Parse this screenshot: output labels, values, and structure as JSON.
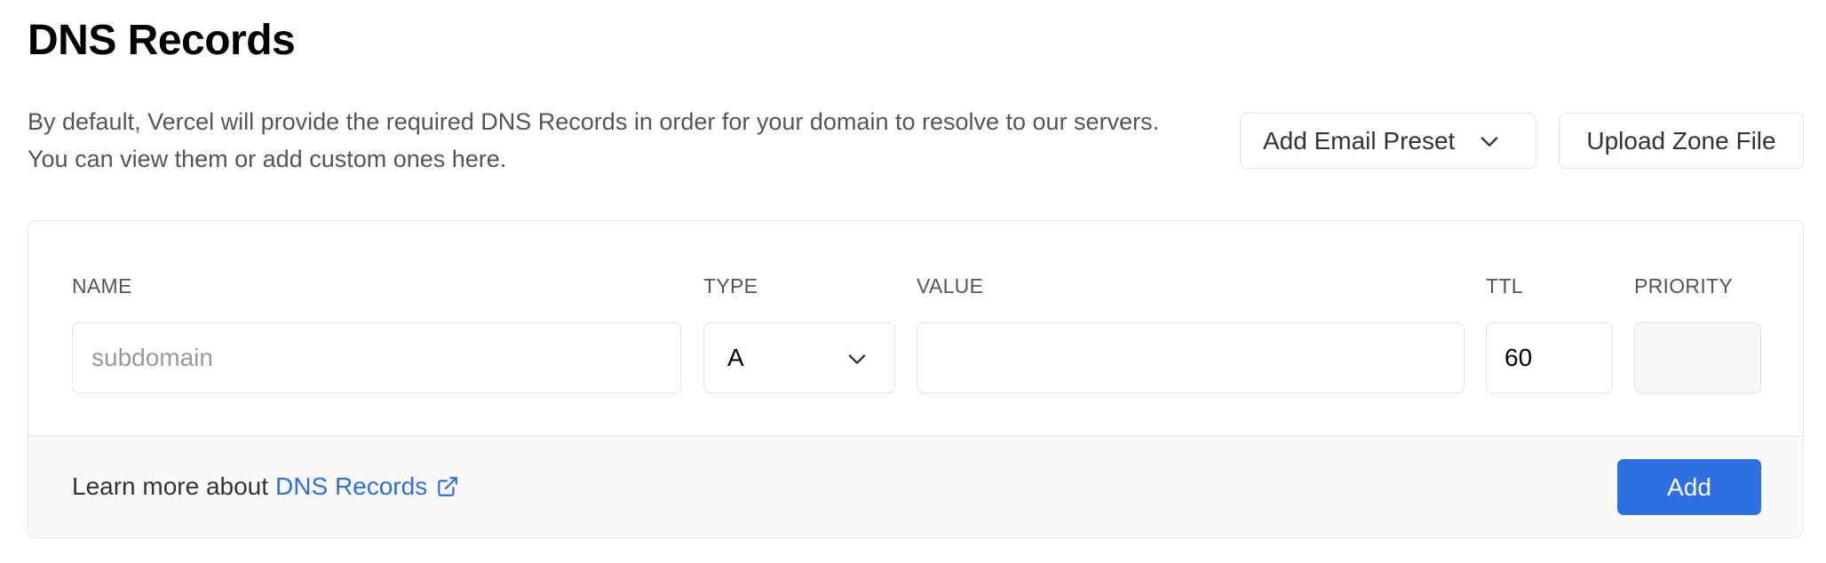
{
  "page": {
    "title": "DNS Records",
    "description": "By default, Vercel will provide the required DNS Records in order for your domain to resolve to our servers. You can view them or add custom ones here."
  },
  "actions": {
    "email_preset_label": "Add Email Preset",
    "upload_zone_label": "Upload Zone File"
  },
  "form": {
    "name_label": "NAME",
    "name_placeholder": "subdomain",
    "type_label": "TYPE",
    "type_value": "A",
    "value_label": "VALUE",
    "value_value": "",
    "ttl_label": "TTL",
    "ttl_value": "60",
    "priority_label": "PRIORITY",
    "priority_value": ""
  },
  "footer": {
    "learn_prefix": "Learn more about",
    "learn_link": "DNS Records",
    "add_label": "Add"
  },
  "colors": {
    "accent": "#2f6fe4",
    "link": "#2d6fe0"
  },
  "icons": {
    "dropdown": "chevron-down-icon",
    "external": "external-link-icon"
  }
}
